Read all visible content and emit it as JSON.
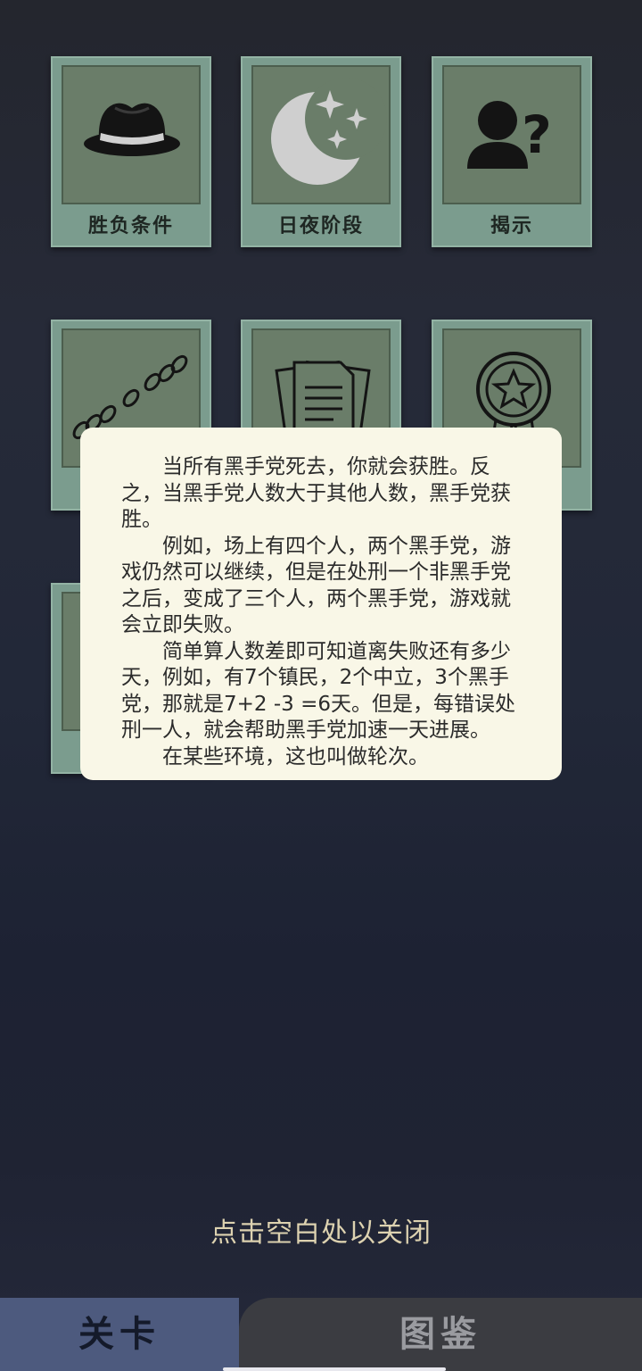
{
  "cards": [
    {
      "label": "胜负条件",
      "icon": "fedora-hat-icon"
    },
    {
      "label": "日夜阶段",
      "icon": "moon-stars-icon"
    },
    {
      "label": "揭示",
      "icon": "person-question-icon"
    },
    {
      "label": "",
      "icon": "footprints-icon"
    },
    {
      "label": "",
      "icon": "documents-icon"
    },
    {
      "label": "",
      "icon": "medal-star-icon"
    },
    {
      "label": "",
      "icon": ""
    }
  ],
  "popup": {
    "paragraphs": [
      "当所有黑手党死去，你就会获胜。反之，当黑手党人数大于其他人数，黑手党获胜。",
      "例如，场上有四个人，两个黑手党，游戏仍然可以继续，但是在处刑一个非黑手党之后，变成了三个人，两个黑手党，游戏就会立即失败。",
      "简单算人数差即可知道离失败还有多少天，例如，有7个镇民，2个中立，3个黑手党，那就是7+2 -3 =6天。但是，每错误处刑一人，就会帮助黑手党加速一天进展。",
      "在某些环境，这也叫做轮次。"
    ]
  },
  "close_hint": "点击空白处以关闭",
  "tabs": {
    "levels": "关卡",
    "codex": "图鉴"
  },
  "colors": {
    "card_frame": "#7b9c8e",
    "card_inner": "#6a7d69",
    "popup_bg": "#f9f7e7",
    "active_tab": "#4d5a7e",
    "inactive_tab": "#3b3c41",
    "hint_text": "#ddd2b0"
  }
}
